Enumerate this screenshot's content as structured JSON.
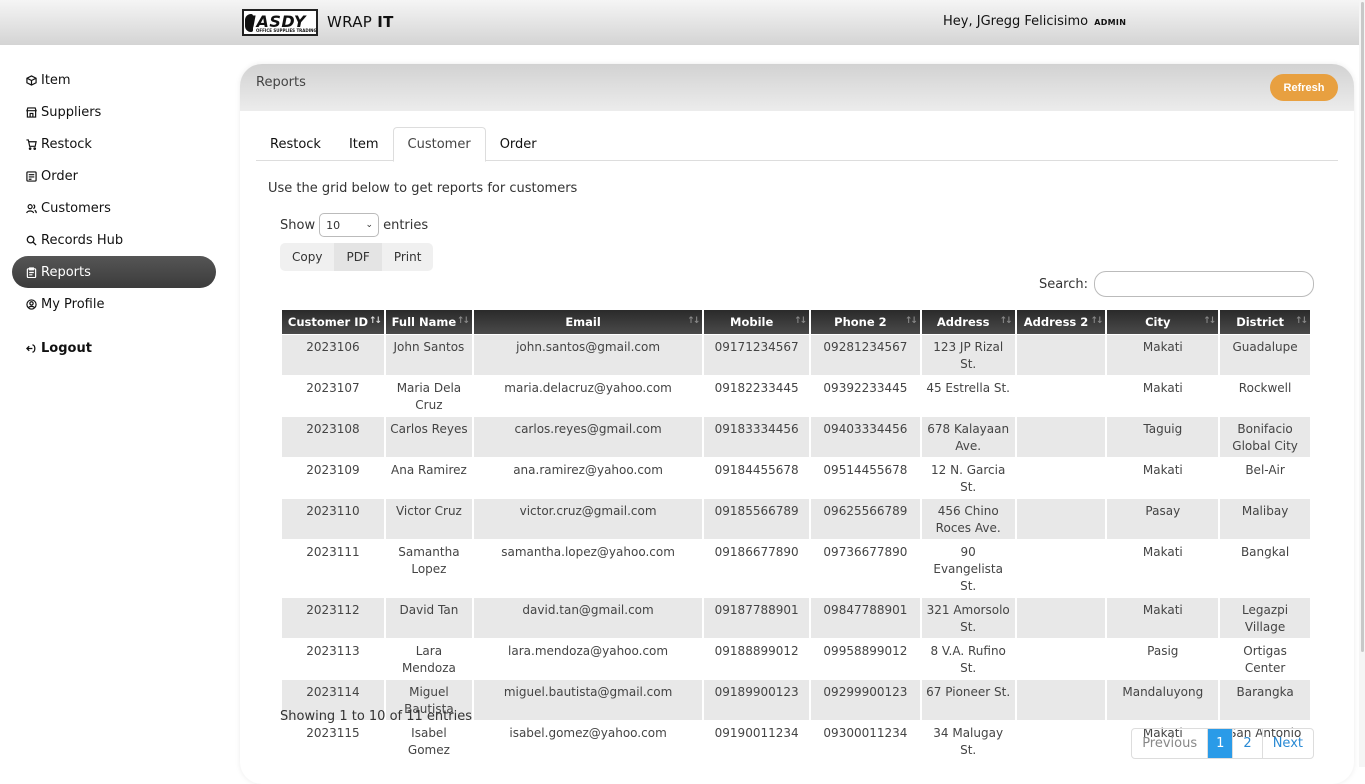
{
  "header": {
    "logo_text": "JASDY",
    "logo_subtext": "OFFICE SUPPLIES TRADING",
    "app_name_part1": "WRAP ",
    "app_name_part2": "IT",
    "greeting": "Hey, JGregg Felicisimo",
    "role": "ADMIN"
  },
  "sidebar": {
    "items": [
      {
        "label": "Item",
        "icon": "cube-icon"
      },
      {
        "label": "Suppliers",
        "icon": "store-icon"
      },
      {
        "label": "Restock",
        "icon": "cart-icon"
      },
      {
        "label": "Order",
        "icon": "order-icon"
      },
      {
        "label": "Customers",
        "icon": "users-icon"
      },
      {
        "label": "Records Hub",
        "icon": "search-icon"
      },
      {
        "label": "Reports",
        "icon": "clipboard-icon"
      },
      {
        "label": "My Profile",
        "icon": "user-circle-icon"
      }
    ],
    "active": "Reports",
    "logout_label": "Logout"
  },
  "card": {
    "title": "Reports",
    "refresh_label": "Refresh"
  },
  "tabs": [
    {
      "label": "Restock"
    },
    {
      "label": "Item"
    },
    {
      "label": "Customer"
    },
    {
      "label": "Order"
    }
  ],
  "active_tab": "Customer",
  "intro_text": "Use the grid below to get reports for customers",
  "length_menu": {
    "show_label": "Show",
    "value": "10",
    "entries_label": "entries"
  },
  "export_buttons": {
    "copy": "Copy",
    "pdf": "PDF",
    "print": "Print"
  },
  "search": {
    "label": "Search:",
    "value": ""
  },
  "table": {
    "columns": [
      "Customer ID",
      "Full Name",
      "Email",
      "Mobile",
      "Phone 2",
      "Address",
      "Address 2",
      "City",
      "District"
    ],
    "rows": [
      [
        "2023106",
        "John Santos",
        "john.santos@gmail.com",
        "09171234567",
        "09281234567",
        "123 JP Rizal St.",
        "",
        "Makati",
        "Guadalupe"
      ],
      [
        "2023107",
        "Maria Dela Cruz",
        "maria.delacruz@yahoo.com",
        "09182233445",
        "09392233445",
        "45 Estrella St.",
        "",
        "Makati",
        "Rockwell"
      ],
      [
        "2023108",
        "Carlos Reyes",
        "carlos.reyes@gmail.com",
        "09183334456",
        "09403334456",
        "678 Kalayaan Ave.",
        "",
        "Taguig",
        "Bonifacio Global City"
      ],
      [
        "2023109",
        "Ana Ramirez",
        "ana.ramirez@yahoo.com",
        "09184455678",
        "09514455678",
        "12 N. Garcia St.",
        "",
        "Makati",
        "Bel-Air"
      ],
      [
        "2023110",
        "Victor Cruz",
        "victor.cruz@gmail.com",
        "09185566789",
        "09625566789",
        "456 Chino Roces Ave.",
        "",
        "Pasay",
        "Malibay"
      ],
      [
        "2023111",
        "Samantha Lopez",
        "samantha.lopez@yahoo.com",
        "09186677890",
        "09736677890",
        "90 Evangelista St.",
        "",
        "Makati",
        "Bangkal"
      ],
      [
        "2023112",
        "David Tan",
        "david.tan@gmail.com",
        "09187788901",
        "09847788901",
        "321 Amorsolo St.",
        "",
        "Makati",
        "Legazpi Village"
      ],
      [
        "2023113",
        "Lara Mendoza",
        "lara.mendoza@yahoo.com",
        "09188899012",
        "09958899012",
        "8 V.A. Rufino St.",
        "",
        "Pasig",
        "Ortigas Center"
      ],
      [
        "2023114",
        "Miguel Bautista",
        "miguel.bautista@gmail.com",
        "09189900123",
        "09299900123",
        "67 Pioneer St.",
        "",
        "Mandaluyong",
        "Barangka"
      ],
      [
        "2023115",
        "Isabel Gomez",
        "isabel.gomez@yahoo.com",
        "09190011234",
        "09300011234",
        "34 Malugay St.",
        "",
        "Makati",
        "San Antonio"
      ]
    ]
  },
  "info_text": "Showing 1 to 10 of 11 entries",
  "pagination": {
    "previous": "Previous",
    "pages": [
      "1",
      "2"
    ],
    "current": "1",
    "next": "Next"
  },
  "colors": {
    "accent_orange": "#e8a040",
    "active_nav": "#444444",
    "page_current": "#2a9be8",
    "link_blue": "#2a8ad4"
  }
}
